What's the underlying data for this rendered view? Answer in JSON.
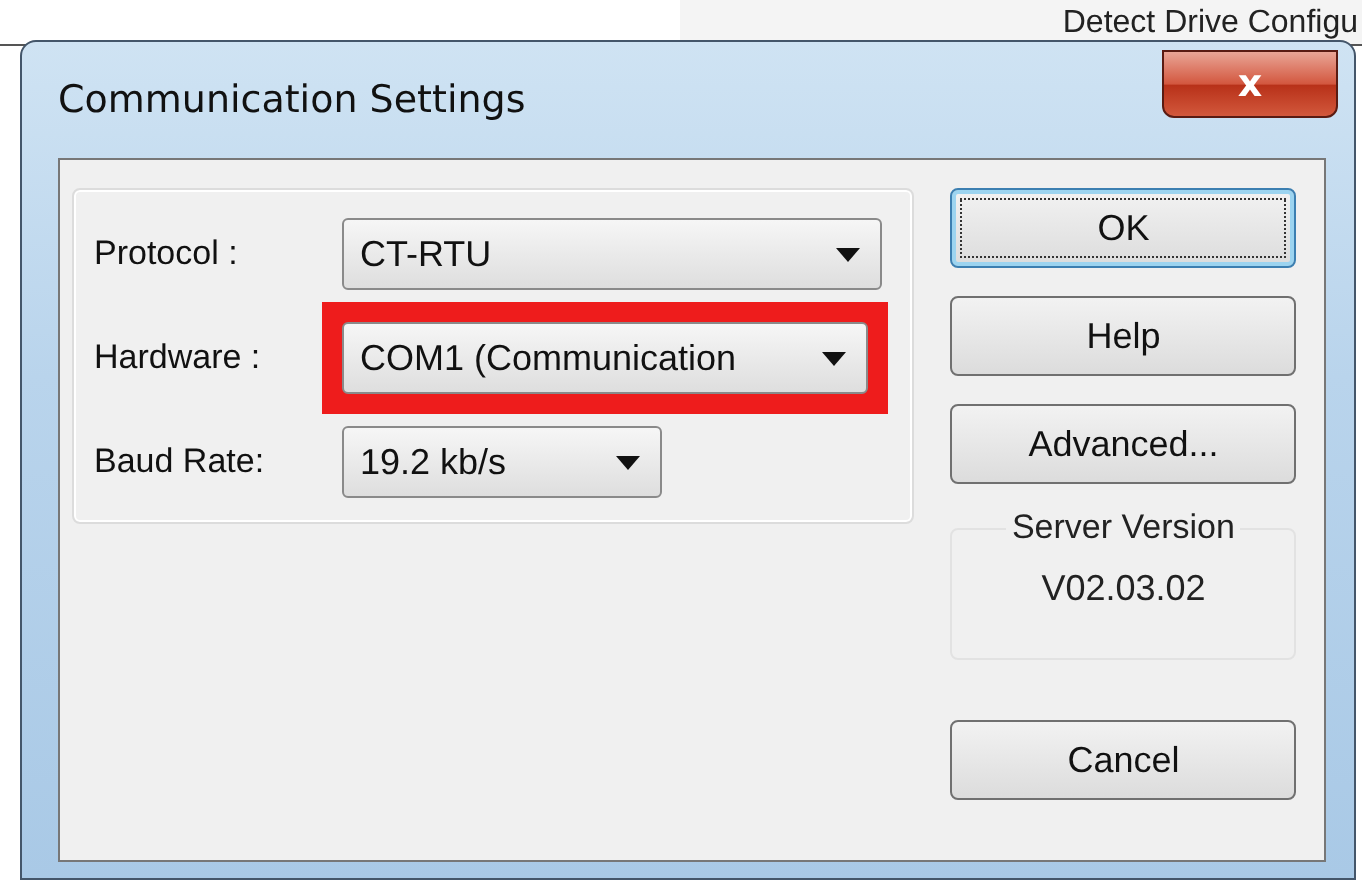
{
  "background_window": {
    "text": "Detect Drive Configu"
  },
  "window": {
    "title": "Communication Settings",
    "close_label": "x"
  },
  "fields": [
    {
      "label": "Protocol :",
      "value": "CT-RTU",
      "highlighted": false
    },
    {
      "label": "Hardware :",
      "value": "COM1 (Communication",
      "highlighted": true
    },
    {
      "label": "Baud Rate:",
      "value": "19.2 kb/s",
      "highlighted": false
    }
  ],
  "buttons": [
    {
      "label": "OK",
      "default": true
    },
    {
      "label": "Help",
      "default": false
    },
    {
      "label": "Advanced...",
      "default": false
    }
  ],
  "server_version": {
    "label": "Server Version",
    "value": "V02.03.02"
  },
  "cancel_button": {
    "label": "Cancel"
  }
}
